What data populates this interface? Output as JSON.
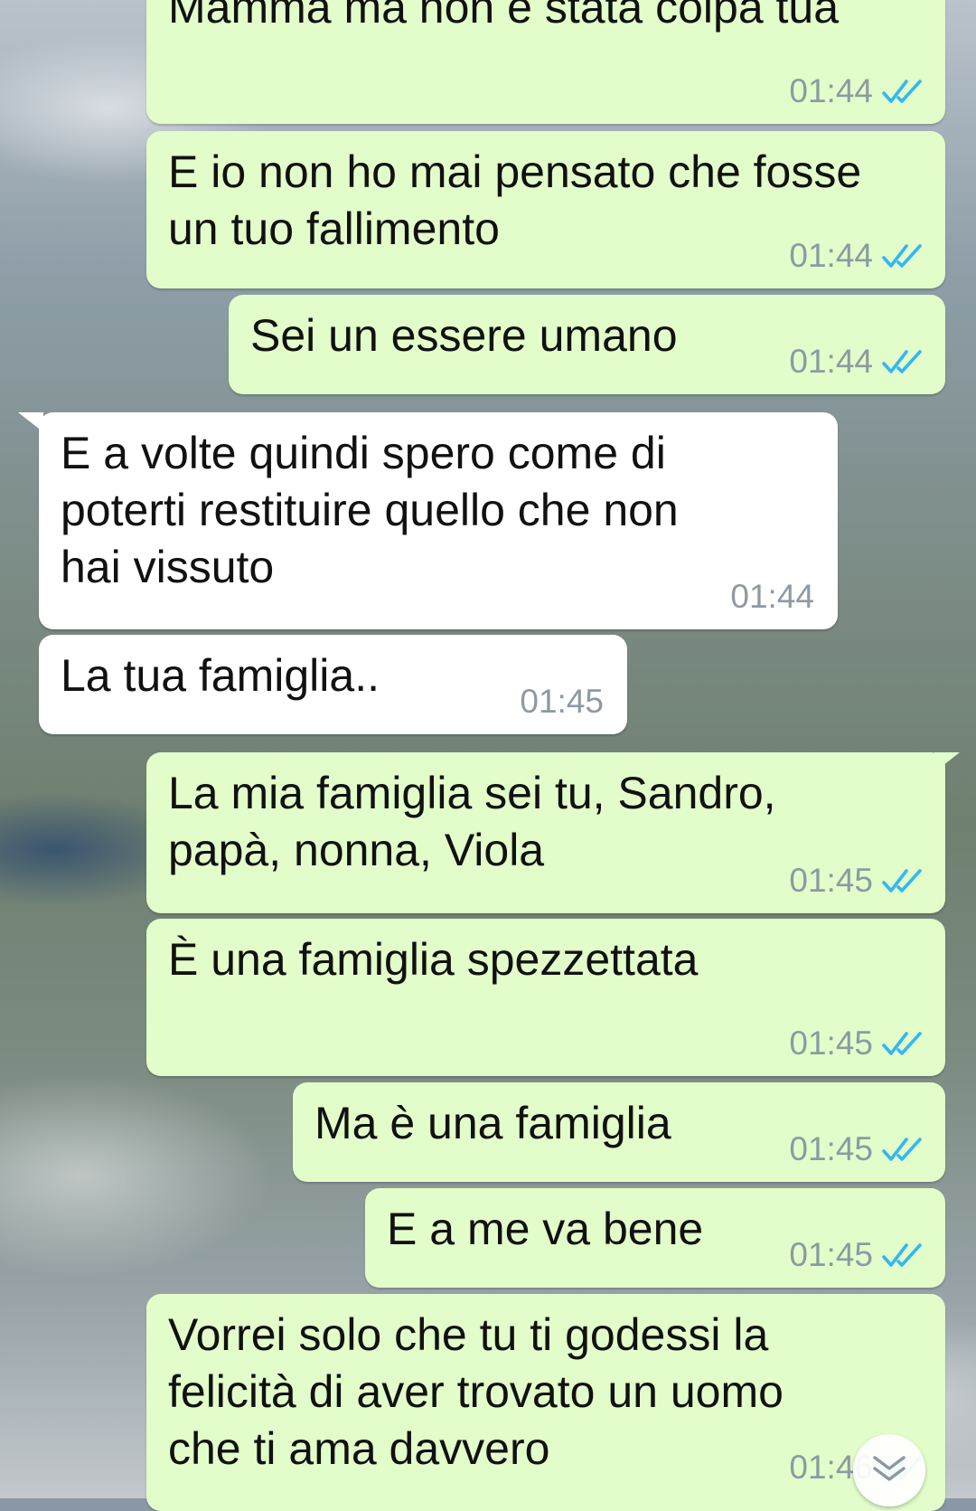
{
  "messages": [
    {
      "id": "m0",
      "direction": "out",
      "text": "Mamma ma non è stata colpa tua",
      "time": "01:44",
      "status": "read"
    },
    {
      "id": "m1",
      "direction": "out",
      "text": "E io non ho mai pensato che fosse\nun tuo fallimento",
      "time": "01:44",
      "status": "read"
    },
    {
      "id": "m2",
      "direction": "out",
      "text": "Sei un essere umano",
      "time": "01:44",
      "status": "read"
    },
    {
      "id": "m3",
      "direction": "in",
      "text": "E a volte quindi spero come di\npoterti restituire quello che non\nhai vissuto",
      "time": "01:44"
    },
    {
      "id": "m4",
      "direction": "in",
      "text": "La tua famiglia..",
      "time": "01:45"
    },
    {
      "id": "m5",
      "direction": "out",
      "text": "La mia famiglia sei tu, Sandro,\npapà, nonna, Viola",
      "time": "01:45",
      "status": "read"
    },
    {
      "id": "m6",
      "direction": "out",
      "text": "È una famiglia spezzettata",
      "time": "01:45",
      "status": "read"
    },
    {
      "id": "m7",
      "direction": "out",
      "text": "Ma è una famiglia",
      "time": "01:45",
      "status": "read"
    },
    {
      "id": "m8",
      "direction": "out",
      "text": "E a me va bene",
      "time": "01:45",
      "status": "read"
    },
    {
      "id": "m9",
      "direction": "out",
      "text": "Vorrei solo che tu ti godessi la\nfelicità di aver trovato un uomo\nche ti ama davvero",
      "time": "01:46",
      "status": "read"
    }
  ],
  "icons": {
    "read_receipt": "double-check-icon",
    "scroll_down": "chevron-double-down-icon"
  },
  "colors": {
    "outgoing_bubble": "#e2fdca",
    "incoming_bubble": "#ffffff",
    "read_tick": "#34b7f1",
    "timestamp": "#8d9aa1"
  }
}
